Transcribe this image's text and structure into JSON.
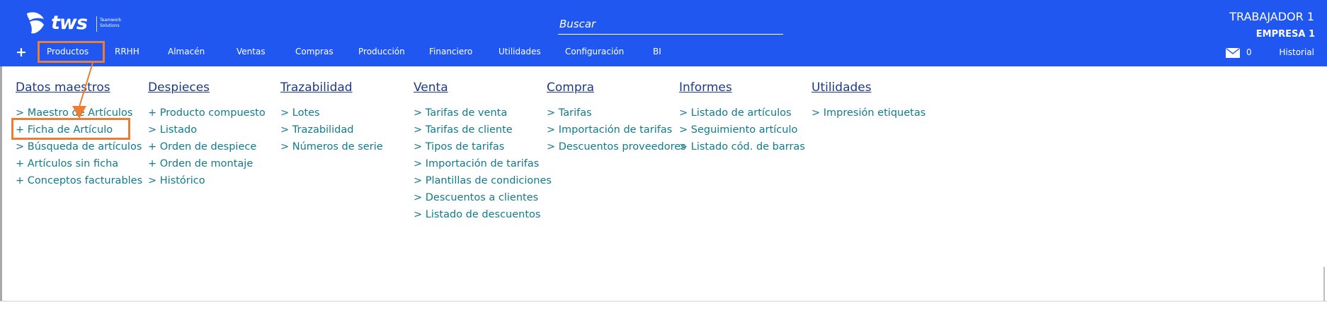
{
  "brand": {
    "logo_text": "tws",
    "logo_tagline": "Teamwork\nSolutions"
  },
  "search": {
    "placeholder": "Buscar"
  },
  "user": {
    "worker": "TRABAJADOR 1",
    "company": "EMPRESA 1"
  },
  "nav": {
    "plus": "+",
    "items": [
      "Productos",
      "RRHH",
      "Almacén",
      "Ventas",
      "Compras",
      "Producción",
      "Financiero",
      "Utilidades",
      "Configuración",
      "BI"
    ],
    "mail_count": "0",
    "history": "Historial"
  },
  "menu": {
    "columns": [
      {
        "title": "Datos maestros",
        "items": [
          "> Maestro de Artículos",
          "+ Ficha de Artículo",
          "> Búsqueda de artículos",
          "+ Artículos sin ficha",
          "+ Conceptos facturables"
        ]
      },
      {
        "title": "Despieces",
        "items": [
          "+ Producto compuesto",
          "> Listado",
          "+ Orden de despiece",
          "+ Orden de montaje",
          "> Histórico"
        ]
      },
      {
        "title": "Trazabilidad",
        "items": [
          "> Lotes",
          "> Trazabilidad",
          "> Números de serie"
        ]
      },
      {
        "title": "Venta",
        "items": [
          "> Tarifas de venta",
          "> Tarifas de cliente",
          "> Tipos de tarifas",
          "> Importación de tarifas",
          "> Plantillas de condiciones",
          "> Descuentos a clientes",
          "> Listado de descuentos"
        ]
      },
      {
        "title": "Compra",
        "items": [
          "> Tarifas",
          "> Importación de tarifas",
          "> Descuentos proveedores"
        ]
      },
      {
        "title": "Informes",
        "items": [
          "> Listado de artículos",
          "> Seguimiento artículo",
          "> Listado cód. de barras"
        ]
      },
      {
        "title": "Utilidades",
        "items": [
          "> Impresión etiquetas"
        ]
      }
    ]
  },
  "colors": {
    "topbar": "#1f57f0",
    "menu_heading": "#1e3a84",
    "menu_link": "#127a8c",
    "annotation": "#ed7d31"
  },
  "icons": {
    "logo": "butterfly-logo-icon",
    "mail": "envelope-icon",
    "arrow": "annotation-arrow"
  }
}
